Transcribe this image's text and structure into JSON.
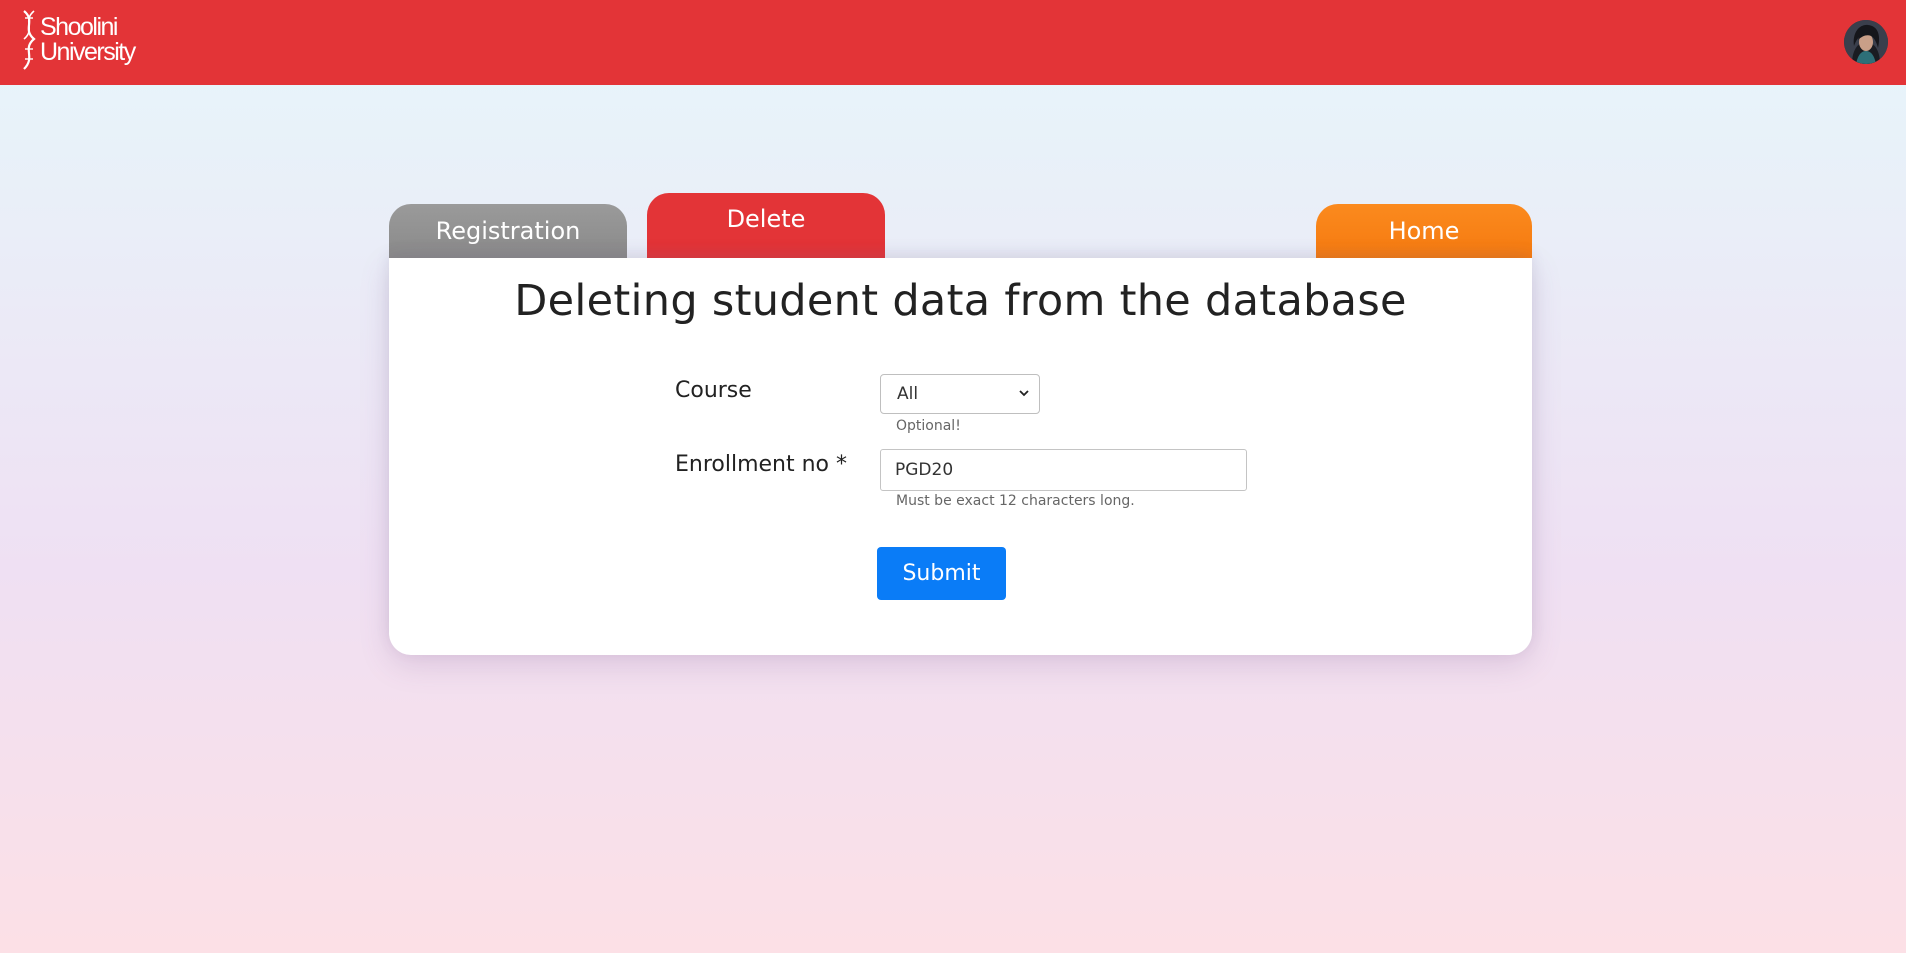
{
  "header": {
    "logo_line1": "Shoolini",
    "logo_line2": "University",
    "brand_color": "#e33437"
  },
  "tabs": [
    {
      "label": "Registration",
      "color": "#8f8f8f"
    },
    {
      "label": "Delete",
      "color": "#e33437",
      "active": true
    },
    {
      "label": "Home",
      "color": "#f7821a"
    }
  ],
  "card": {
    "title": "Deleting student data from the database",
    "course": {
      "label": "Course",
      "selected": "All",
      "hint": "Optional!"
    },
    "enrollment": {
      "label": "Enrollment no *",
      "value": "PGD20",
      "hint": "Must be exact 12 characters long."
    },
    "submit_label": "Submit",
    "submit_color": "#0a7cf7"
  }
}
